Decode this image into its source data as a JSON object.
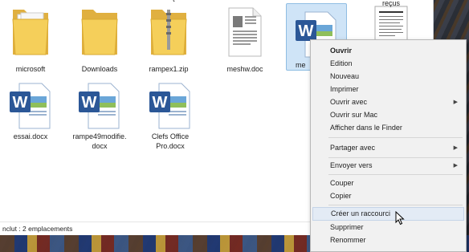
{
  "files": [
    {
      "label": "microsoft",
      "icon": "folder-icon"
    },
    {
      "label": "Downloads",
      "icon": "folder-icon"
    },
    {
      "label": "rampex1.zip",
      "icon": "zip-folder-icon"
    },
    {
      "label": "meshw.doc",
      "icon": "document-icon"
    },
    {
      "label": "me",
      "icon": "word-document-icon"
    },
    {
      "label": "reçus",
      "icon": "document-thumbnail-icon"
    },
    {
      "label": "essai.docx",
      "icon": "word-document-icon"
    },
    {
      "label": "rampe49modifie.\ndocx",
      "icon": "word-document-icon"
    },
    {
      "label": "Clefs Office\nPro.docx",
      "icon": "word-document-icon"
    }
  ],
  "partial_top_label": "t",
  "status_text": "nclut : 2 emplacements",
  "context_menu": {
    "items": [
      {
        "label": "Ouvrir",
        "bold": true
      },
      {
        "label": "Edition"
      },
      {
        "label": "Nouveau"
      },
      {
        "label": "Imprimer"
      },
      {
        "label": "Ouvrir avec",
        "submenu": true
      },
      {
        "label": "Ouvrir sur Mac"
      },
      {
        "label": "Afficher dans le Finder"
      },
      {
        "label": "Partager avec",
        "submenu": true
      },
      {
        "label": "Envoyer vers",
        "submenu": true
      },
      {
        "label": "Couper"
      },
      {
        "label": "Copier"
      },
      {
        "label": "Créer un raccourci",
        "hover": true
      },
      {
        "label": "Supprimer"
      },
      {
        "label": "Renommer"
      }
    ],
    "submenu_arrow": "▶"
  },
  "colors": {
    "folder": "#f2c94c",
    "word_blue": "#2b5797",
    "selection": "#cfe4f7",
    "menu_bg": "#f1f1f1"
  }
}
